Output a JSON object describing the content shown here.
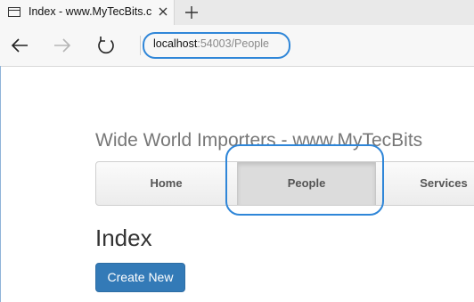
{
  "browser": {
    "tab": {
      "title": "Index - www.MyTecBits.c",
      "icon": "page-icon"
    },
    "address": {
      "host": "localhost",
      "path": ":54003/People"
    },
    "highlight_color": "#2f86d8"
  },
  "page": {
    "site_title": "Wide World Importers - www.MyTecBits",
    "menu": [
      {
        "label": "Home"
      },
      {
        "label": "People",
        "active": true
      },
      {
        "label": "Services"
      }
    ],
    "heading": "Index",
    "create_button": "Create New",
    "accent_color": "#337ab7"
  }
}
